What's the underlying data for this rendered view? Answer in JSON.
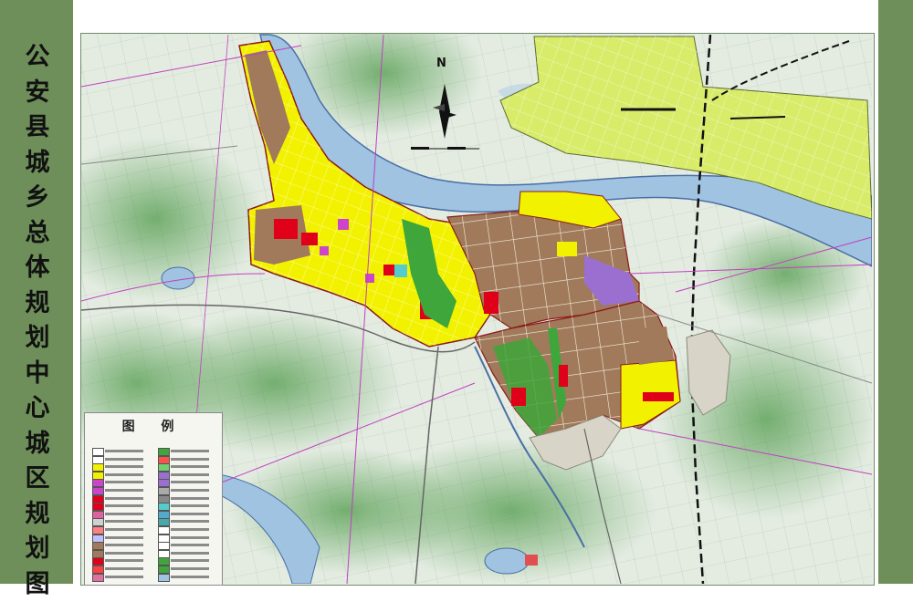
{
  "title": "公安县城乡总体规划中心城区规划图",
  "title_chars": [
    "公",
    "安",
    "县",
    "城",
    "乡",
    "总",
    "体",
    "规",
    "划",
    "中",
    "心",
    "城",
    "区",
    "规",
    "划",
    "图"
  ],
  "legend": {
    "title": "图 例"
  },
  "north_arrow": {
    "label": "N"
  },
  "colors": {
    "strip": "#6e8f5a",
    "river": "#9fc3e0",
    "river_edge": "#4a6fa5",
    "residential": "#f2f200",
    "industrial": "#a07a5a",
    "commercial": "#e0001a",
    "green": "#3ea63a",
    "logistics": "#9a6fd0",
    "reserve": "#d8d4c8",
    "north_town": "#d8ec6a"
  }
}
